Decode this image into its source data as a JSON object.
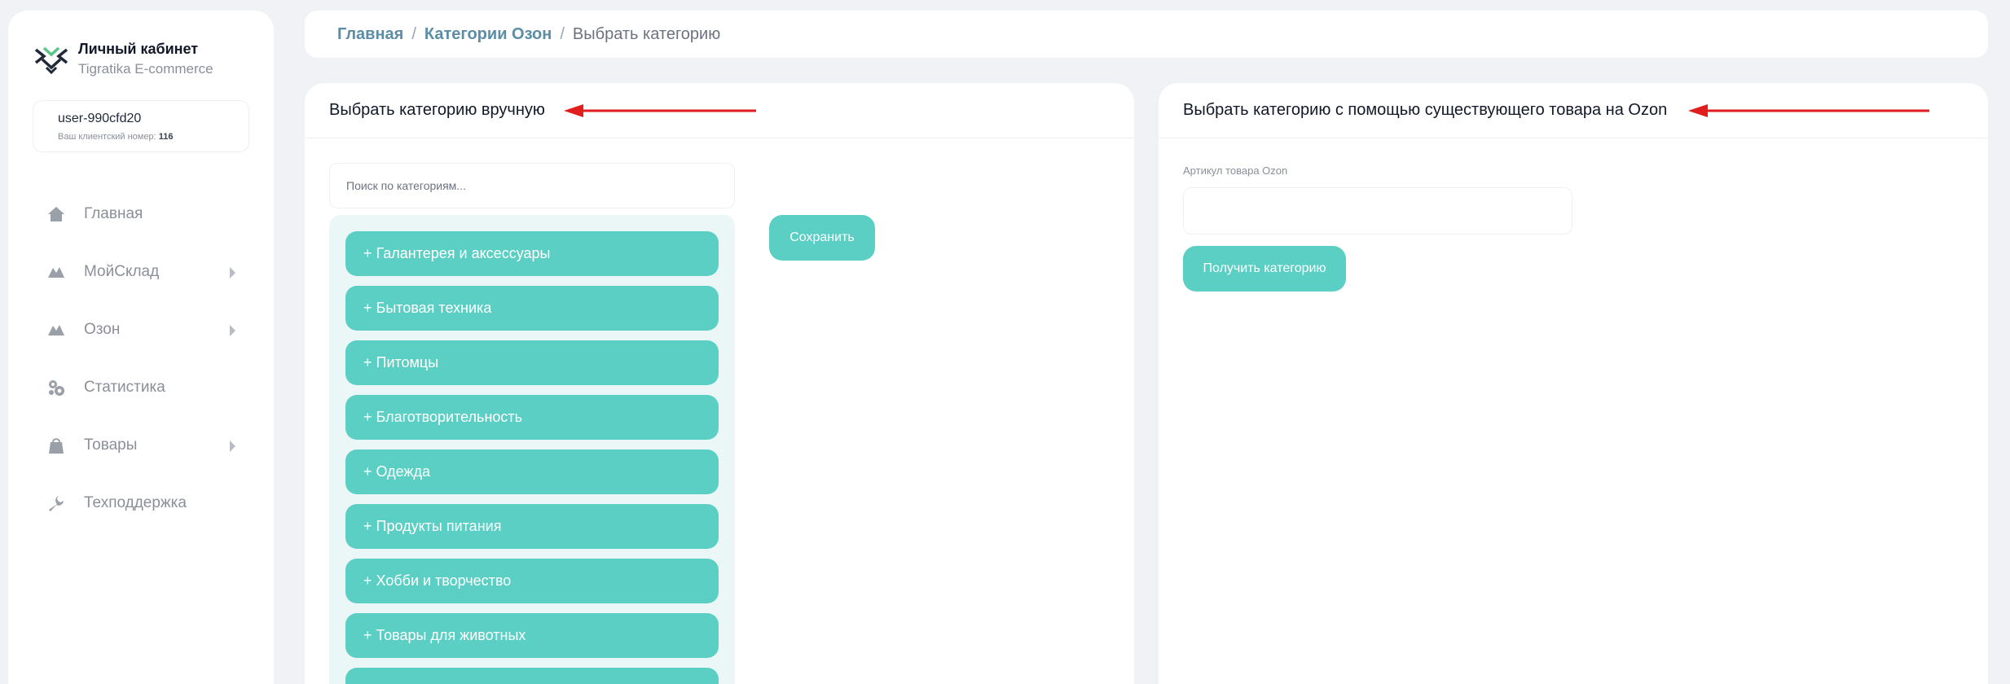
{
  "brand": {
    "title": "Личный кабинет",
    "subtitle": "Tigratika E-commerce",
    "logo_icon": "tigratika-logo-icon"
  },
  "user": {
    "name": "user-990cfd20",
    "client_label": "Ваш клиентский номер:",
    "client_number": "116"
  },
  "sidebar": {
    "items": [
      {
        "label": "Главная",
        "icon": "home-icon",
        "has_arrow": false
      },
      {
        "label": "МойСклад",
        "icon": "mountain-icon",
        "has_arrow": true
      },
      {
        "label": "Озон",
        "icon": "mountain-icon",
        "has_arrow": true
      },
      {
        "label": "Статистика",
        "icon": "gears-icon",
        "has_arrow": false
      },
      {
        "label": "Товары",
        "icon": "bag-icon",
        "has_arrow": true
      },
      {
        "label": "Техподдержка",
        "icon": "wrench-icon",
        "has_arrow": false
      }
    ]
  },
  "breadcrumb": {
    "items": [
      "Главная",
      "Категории Озон"
    ],
    "separator": "/",
    "current": "Выбрать категорию"
  },
  "manual": {
    "title": "Выбрать категорию вручную",
    "search_placeholder": "Поиск по категориям...",
    "save_label": "Сохранить",
    "categories": [
      "+ Галантерея и аксессуары",
      "+ Бытовая техника",
      "+ Питомцы",
      "+ Благотворительность",
      "+ Одежда",
      "+ Продукты питания",
      "+ Хобби и творчество",
      "+ Товары для животных"
    ]
  },
  "by_product": {
    "title": "Выбрать категорию с помощью существующего товара на Ozon",
    "field_label": "Артикул товара Ozon",
    "field_value": "",
    "button_label": "Получить категорию"
  },
  "colors": {
    "accent": "#5bcfc4",
    "panel": "#eaf7f6",
    "link": "#5b8ea6",
    "annotation": "#e11d1d"
  }
}
